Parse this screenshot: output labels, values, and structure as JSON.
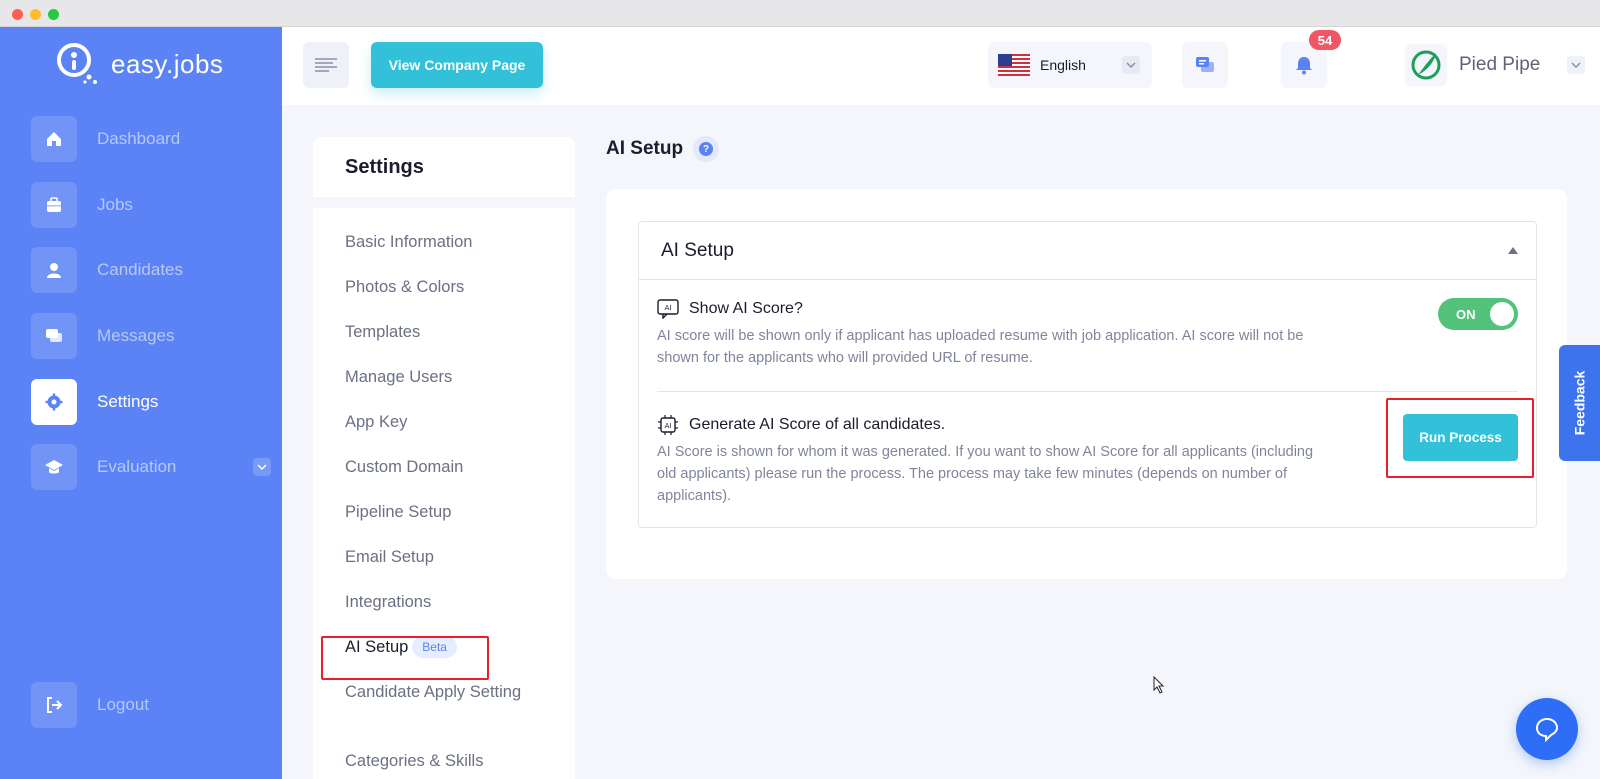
{
  "brand": {
    "name": "easy.jobs"
  },
  "sidebar": {
    "items": [
      {
        "label": "Dashboard",
        "icon": "home-icon"
      },
      {
        "label": "Jobs",
        "icon": "briefcase-icon"
      },
      {
        "label": "Candidates",
        "icon": "user-icon"
      },
      {
        "label": "Messages",
        "icon": "chat-icon"
      },
      {
        "label": "Settings",
        "icon": "gear-icon",
        "active": true
      },
      {
        "label": "Evaluation",
        "icon": "graduation-cap-icon",
        "expandable": true
      }
    ],
    "logout": {
      "label": "Logout",
      "icon": "logout-icon"
    }
  },
  "header": {
    "view_company_label": "View Company Page",
    "language": {
      "label": "English",
      "flag": "us-flag-icon"
    },
    "notifications": {
      "count": "54"
    },
    "company": {
      "name": "Pied Pipe"
    }
  },
  "settings": {
    "title": "Settings",
    "menu": [
      {
        "label": "Basic Information"
      },
      {
        "label": "Photos & Colors"
      },
      {
        "label": "Templates"
      },
      {
        "label": "Manage Users"
      },
      {
        "label": "App Key"
      },
      {
        "label": "Custom Domain"
      },
      {
        "label": "Pipeline Setup"
      },
      {
        "label": "Email Setup"
      },
      {
        "label": "Integrations"
      },
      {
        "label": "AI Setup",
        "badge": "Beta",
        "active": true
      },
      {
        "label": "Candidate Apply Setting"
      },
      {
        "label": "Categories & Skills"
      }
    ]
  },
  "main": {
    "page_title": "AI Setup",
    "panel_title": "AI Setup",
    "show_ai_score": {
      "title": "Show AI Score?",
      "description": "AI score will be shown only if applicant has uploaded resume with job application. AI score will not be shown for the applicants who will provided URL of resume.",
      "toggle_label": "ON",
      "toggle_on": true
    },
    "generate_ai_score": {
      "title": "Generate AI Score of all candidates.",
      "description": "AI Score is shown for whom it was generated. If you want to show AI Score for all applicants (including old applicants) please run the process. The process may take few minutes (depends on number of applicants).",
      "button_label": "Run Process"
    }
  },
  "feedback": {
    "label": "Feedback"
  },
  "colors": {
    "sidebar": "#5b83f5",
    "accent_cyan": "#32c1d8",
    "toggle_green": "#53c27b",
    "badge_red": "#f05664",
    "highlight_red": "#e8202a"
  }
}
